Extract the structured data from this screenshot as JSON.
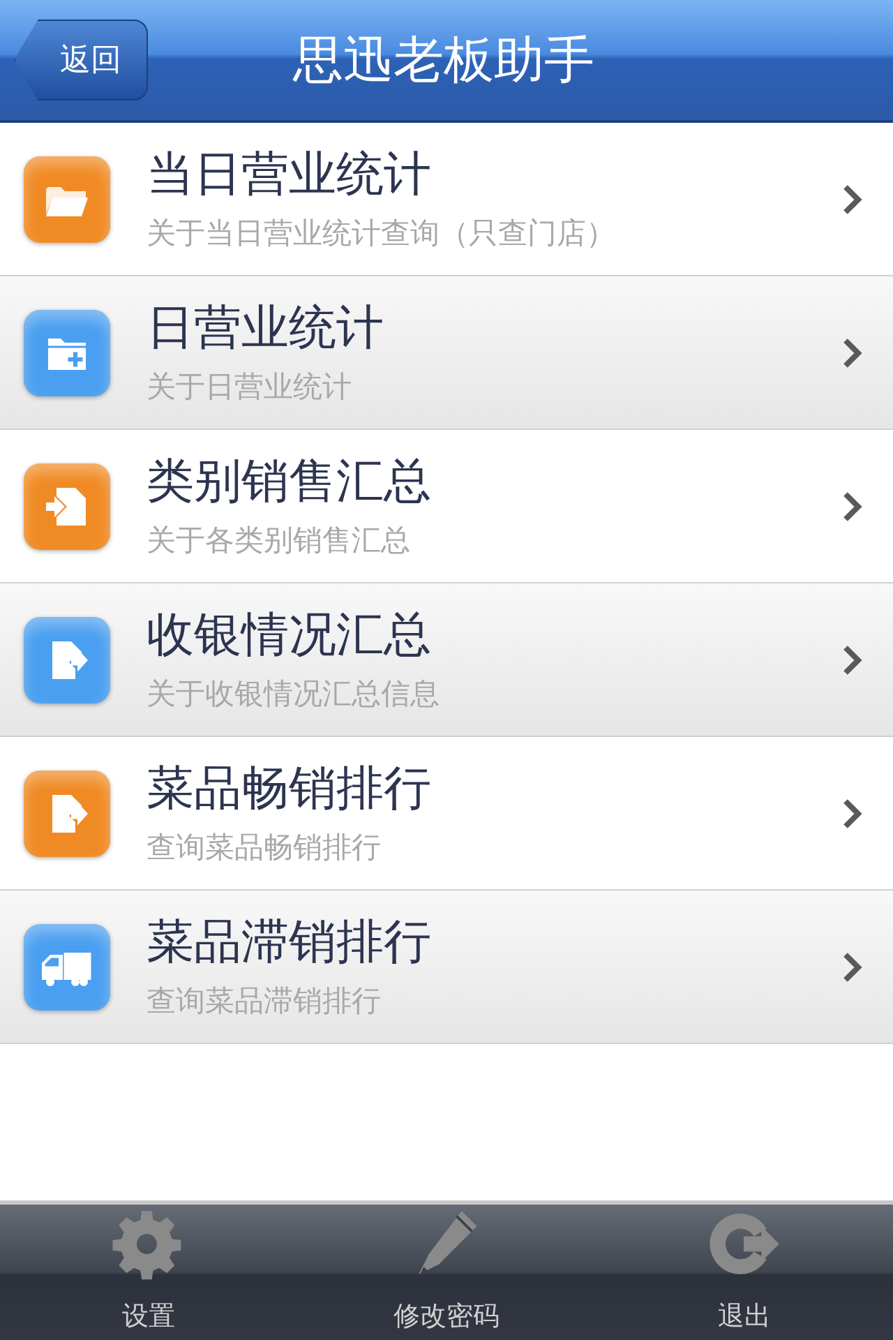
{
  "nav_bar": {
    "back_button": "返回",
    "title": "思迅老板助手"
  },
  "menu": [
    {
      "title": "当日营业统计",
      "subtitle": "关于当日营业统计查询（只查门店）",
      "kind": "folder",
      "color": "#f08a24"
    },
    {
      "title": "日营业统计",
      "subtitle": "关于日营业统计",
      "kind": "folderplus",
      "color": "#4a9ff0"
    },
    {
      "title": "类别销售汇总",
      "subtitle": "关于各类别销售汇总",
      "kind": "import",
      "color": "#f08a24"
    },
    {
      "title": "收银情况汇总",
      "subtitle": "关于收银情况汇总信息",
      "kind": "export",
      "color": "#4a9ff0"
    },
    {
      "title": "菜品畅销排行",
      "subtitle": "查询菜品畅销排行",
      "kind": "export",
      "color": "#f08a24"
    },
    {
      "title": "菜品滞销排行",
      "subtitle": "查询菜品滞销排行",
      "kind": "truck",
      "color": "#4a9ff0"
    }
  ],
  "tab_bar": [
    {
      "label": "设置",
      "kind": "settings"
    },
    {
      "label": "修改密码",
      "kind": "edit"
    },
    {
      "label": "退出",
      "kind": "logout"
    }
  ]
}
